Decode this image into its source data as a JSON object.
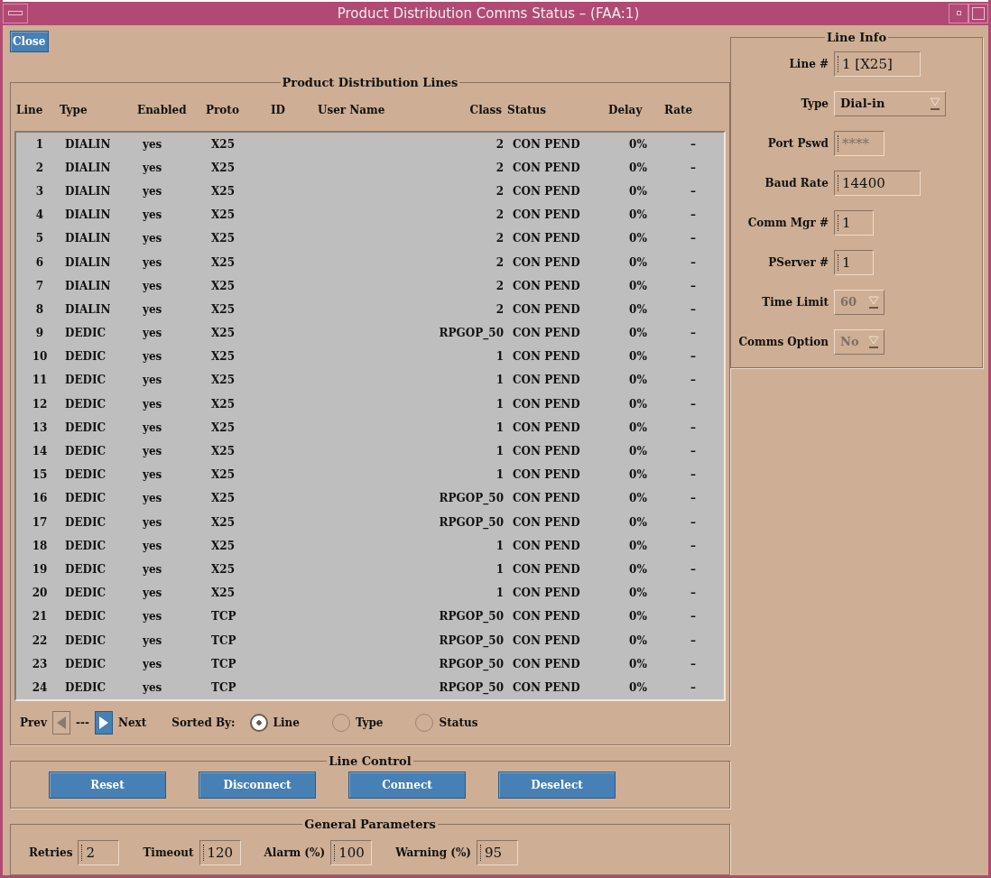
{
  "window": {
    "title": "Product Distribution Comms Status – (FAA:1)"
  },
  "close_button": "Close",
  "lines_panel": {
    "title": "Product Distribution Lines",
    "columns": [
      "Line",
      "Type",
      "Enabled",
      "Proto",
      "ID",
      "User Name",
      "Class",
      "Status",
      "Delay",
      "Rate"
    ],
    "rows": [
      {
        "line": "1",
        "type": "DIALIN",
        "enabled": "yes",
        "proto": "X25",
        "class": "2",
        "status": "CON PEND",
        "delay": "0%",
        "rate": "–"
      },
      {
        "line": "2",
        "type": "DIALIN",
        "enabled": "yes",
        "proto": "X25",
        "class": "2",
        "status": "CON PEND",
        "delay": "0%",
        "rate": "–"
      },
      {
        "line": "3",
        "type": "DIALIN",
        "enabled": "yes",
        "proto": "X25",
        "class": "2",
        "status": "CON PEND",
        "delay": "0%",
        "rate": "–"
      },
      {
        "line": "4",
        "type": "DIALIN",
        "enabled": "yes",
        "proto": "X25",
        "class": "2",
        "status": "CON PEND",
        "delay": "0%",
        "rate": "–"
      },
      {
        "line": "5",
        "type": "DIALIN",
        "enabled": "yes",
        "proto": "X25",
        "class": "2",
        "status": "CON PEND",
        "delay": "0%",
        "rate": "–"
      },
      {
        "line": "6",
        "type": "DIALIN",
        "enabled": "yes",
        "proto": "X25",
        "class": "2",
        "status": "CON PEND",
        "delay": "0%",
        "rate": "–"
      },
      {
        "line": "7",
        "type": "DIALIN",
        "enabled": "yes",
        "proto": "X25",
        "class": "2",
        "status": "CON PEND",
        "delay": "0%",
        "rate": "–"
      },
      {
        "line": "8",
        "type": "DIALIN",
        "enabled": "yes",
        "proto": "X25",
        "class": "2",
        "status": "CON PEND",
        "delay": "0%",
        "rate": "–"
      },
      {
        "line": "9",
        "type": "DEDIC",
        "enabled": "yes",
        "proto": "X25",
        "class": "RPGOP_50",
        "status": "CON PEND",
        "delay": "0%",
        "rate": "–"
      },
      {
        "line": "10",
        "type": "DEDIC",
        "enabled": "yes",
        "proto": "X25",
        "class": "1",
        "status": "CON PEND",
        "delay": "0%",
        "rate": "–"
      },
      {
        "line": "11",
        "type": "DEDIC",
        "enabled": "yes",
        "proto": "X25",
        "class": "1",
        "status": "CON PEND",
        "delay": "0%",
        "rate": "–"
      },
      {
        "line": "12",
        "type": "DEDIC",
        "enabled": "yes",
        "proto": "X25",
        "class": "1",
        "status": "CON PEND",
        "delay": "0%",
        "rate": "–"
      },
      {
        "line": "13",
        "type": "DEDIC",
        "enabled": "yes",
        "proto": "X25",
        "class": "1",
        "status": "CON PEND",
        "delay": "0%",
        "rate": "–"
      },
      {
        "line": "14",
        "type": "DEDIC",
        "enabled": "yes",
        "proto": "X25",
        "class": "1",
        "status": "CON PEND",
        "delay": "0%",
        "rate": "–"
      },
      {
        "line": "15",
        "type": "DEDIC",
        "enabled": "yes",
        "proto": "X25",
        "class": "1",
        "status": "CON PEND",
        "delay": "0%",
        "rate": "–"
      },
      {
        "line": "16",
        "type": "DEDIC",
        "enabled": "yes",
        "proto": "X25",
        "class": "RPGOP_50",
        "status": "CON PEND",
        "delay": "0%",
        "rate": "–"
      },
      {
        "line": "17",
        "type": "DEDIC",
        "enabled": "yes",
        "proto": "X25",
        "class": "RPGOP_50",
        "status": "CON PEND",
        "delay": "0%",
        "rate": "–"
      },
      {
        "line": "18",
        "type": "DEDIC",
        "enabled": "yes",
        "proto": "X25",
        "class": "1",
        "status": "CON PEND",
        "delay": "0%",
        "rate": "–"
      },
      {
        "line": "19",
        "type": "DEDIC",
        "enabled": "yes",
        "proto": "X25",
        "class": "1",
        "status": "CON PEND",
        "delay": "0%",
        "rate": "–"
      },
      {
        "line": "20",
        "type": "DEDIC",
        "enabled": "yes",
        "proto": "X25",
        "class": "1",
        "status": "CON PEND",
        "delay": "0%",
        "rate": "–"
      },
      {
        "line": "21",
        "type": "DEDIC",
        "enabled": "yes",
        "proto": "TCP",
        "class": "RPGOP_50",
        "status": "CON PEND",
        "delay": "0%",
        "rate": "–"
      },
      {
        "line": "22",
        "type": "DEDIC",
        "enabled": "yes",
        "proto": "TCP",
        "class": "RPGOP_50",
        "status": "CON PEND",
        "delay": "0%",
        "rate": "–"
      },
      {
        "line": "23",
        "type": "DEDIC",
        "enabled": "yes",
        "proto": "TCP",
        "class": "RPGOP_50",
        "status": "CON PEND",
        "delay": "0%",
        "rate": "–"
      },
      {
        "line": "24",
        "type": "DEDIC",
        "enabled": "yes",
        "proto": "TCP",
        "class": "RPGOP_50",
        "status": "CON PEND",
        "delay": "0%",
        "rate": "–"
      }
    ],
    "pager": {
      "prev_label": "Prev",
      "prev_disabled": true,
      "page": "---",
      "next_label": "Next",
      "next_disabled": false
    },
    "sort": {
      "label": "Sorted By:",
      "options": [
        {
          "label": "Line",
          "selected": true
        },
        {
          "label": "Type",
          "selected": false
        },
        {
          "label": "Status",
          "selected": false
        }
      ]
    }
  },
  "line_control": {
    "title": "Line Control",
    "buttons": [
      "Reset",
      "Disconnect",
      "Connect",
      "Deselect"
    ]
  },
  "general_parameters": {
    "title": "General Parameters",
    "fields": [
      {
        "label": "Retries",
        "value": "2"
      },
      {
        "label": "Timeout",
        "value": "120"
      },
      {
        "label": "Alarm (%)",
        "value": "100"
      },
      {
        "label": "Warning (%)",
        "value": "95"
      }
    ]
  },
  "line_info": {
    "title": "Line Info",
    "fields": [
      {
        "kind": "text",
        "label": "Line #",
        "value": "1  [X25]",
        "disabled": false
      },
      {
        "kind": "dropdown",
        "label": "Type",
        "value": "Dial-in",
        "disabled": false
      },
      {
        "kind": "text",
        "label": "Port Pswd",
        "value": "****",
        "disabled": true
      },
      {
        "kind": "text",
        "label": "Baud Rate",
        "value": "14400",
        "disabled": false
      },
      {
        "kind": "text",
        "label": "Comm Mgr #",
        "value": "1",
        "disabled": false
      },
      {
        "kind": "text",
        "label": "PServer #",
        "value": "1",
        "disabled": false
      },
      {
        "kind": "dropdown",
        "label": "Time Limit",
        "value": "60",
        "disabled": true
      },
      {
        "kind": "dropdown",
        "label": "Comms Option",
        "value": "No",
        "disabled": true
      }
    ]
  }
}
